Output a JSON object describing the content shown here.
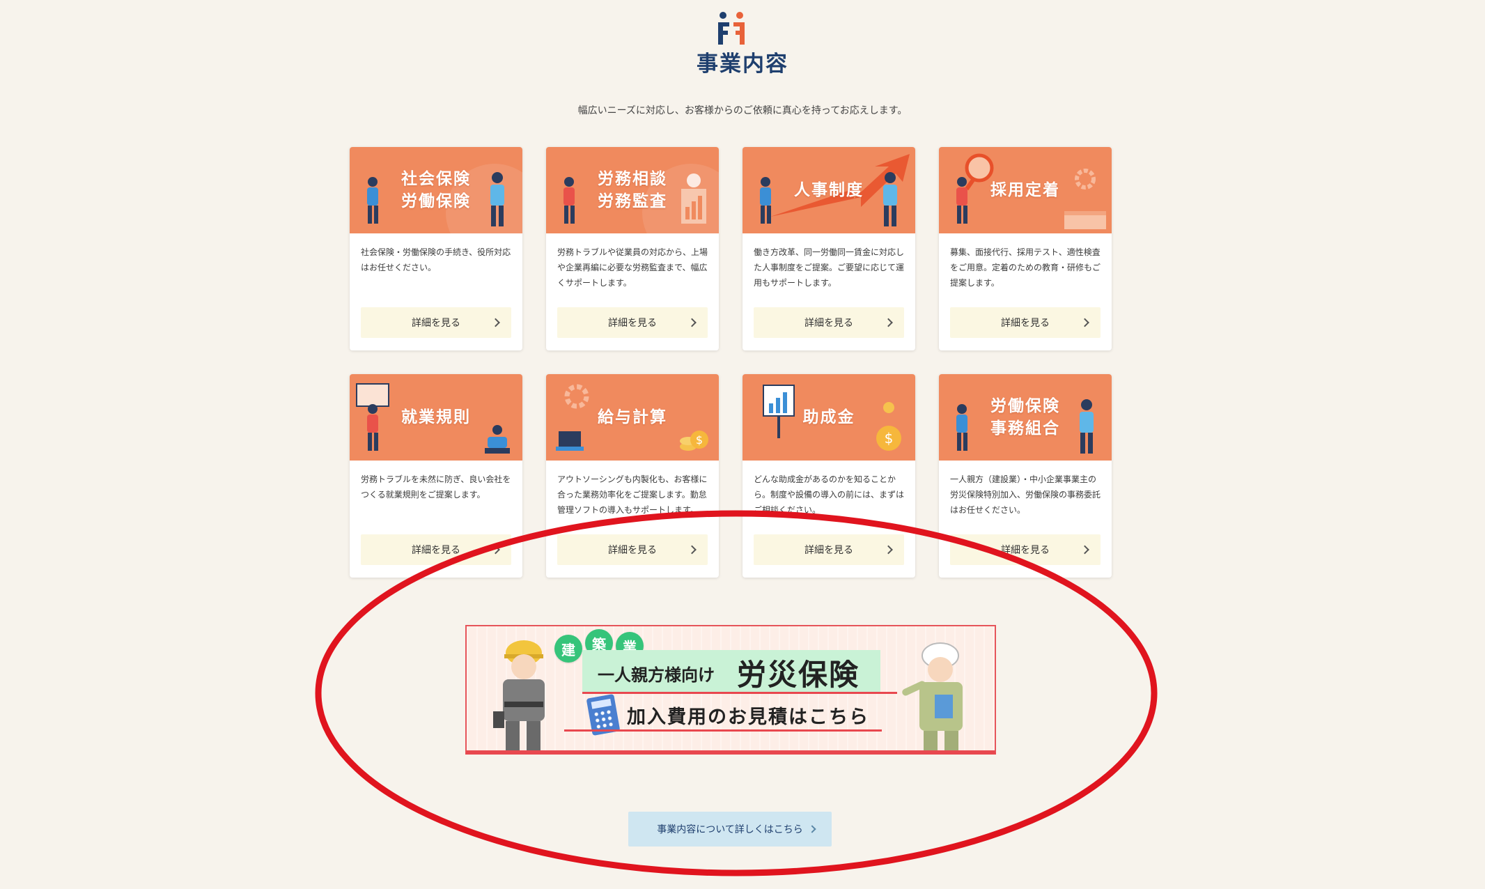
{
  "section": {
    "title": "事業内容",
    "lead": "幅広いニーズに対応し、お客様からのご依頼に真心を持ってお応えします。"
  },
  "cards": [
    {
      "title_lines": [
        "社会保険",
        "労働保険"
      ],
      "desc": "社会保険・労働保険の手続き、役所対応はお任せください。",
      "button": "詳細を見る"
    },
    {
      "title_lines": [
        "労務相談",
        "労務監査"
      ],
      "desc": "労務トラブルや従業員の対応から、上場や企業再編に必要な労務監査まで、幅広くサポートします。",
      "button": "詳細を見る"
    },
    {
      "title_lines": [
        "人事制度",
        ""
      ],
      "desc": "働き方改革、同一労働同一賃金に対応した人事制度をご提案。ご要望に応じて運用もサポートします。",
      "button": "詳細を見る"
    },
    {
      "title_lines": [
        "採用定着",
        ""
      ],
      "desc": "募集、面接代行、採用テスト、適性検査をご用意。定着のための教育・研修もご提案します。",
      "button": "詳細を見る"
    },
    {
      "title_lines": [
        "就業規則",
        ""
      ],
      "desc": "労務トラブルを未然に防ぎ、良い会社をつくる就業規則をご提案します。",
      "button": "詳細を見る"
    },
    {
      "title_lines": [
        "給与計算",
        ""
      ],
      "desc": "アウトソーシングも内製化も、お客様に合った業務効率化をご提案します。勤怠管理ソフトの導入もサポートします。",
      "button": "詳細を見る"
    },
    {
      "title_lines": [
        "助成金",
        ""
      ],
      "desc": "どんな助成金があるのかを知ることから。制度や設備の導入の前には、まずはご相談ください。",
      "button": "詳細を見る"
    },
    {
      "title_lines": [
        "労働保険",
        "事務組合"
      ],
      "desc": "一人親方（建設業）・中小企業事業主の労災保険特別加入、労働保険の事務委託はお任せください。",
      "button": "詳細を見る"
    }
  ],
  "banner": {
    "badges": [
      "建",
      "築",
      "業"
    ],
    "headline_small": "一人親方様向け",
    "headline_big": "労災保険",
    "sub": "加入費用のお見積はこちら"
  },
  "more_button": "事業内容について詳しくはこちら",
  "colors": {
    "card_hero": "#f08a5e",
    "navy": "#1f3f6e",
    "annotation": "#e0141e"
  }
}
